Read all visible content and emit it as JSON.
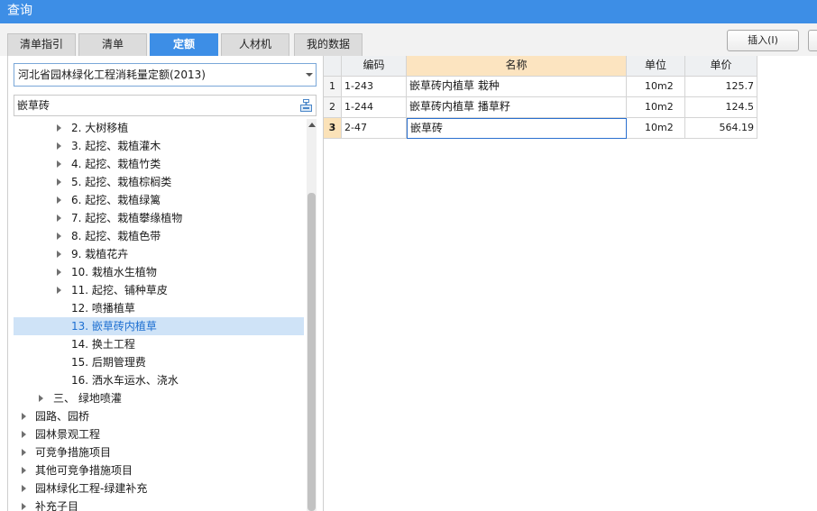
{
  "window": {
    "title": "查询"
  },
  "tabs": [
    {
      "label": "清单指引",
      "active": false
    },
    {
      "label": "清单",
      "active": false
    },
    {
      "label": "定额",
      "active": true
    },
    {
      "label": "人材机",
      "active": false
    },
    {
      "label": "我的数据",
      "active": false
    }
  ],
  "toolbar": {
    "insert_label": "插入(I)"
  },
  "colors": {
    "accent": "#3d8ee6",
    "selection": "#cfe3f7",
    "header_highlight": "#fce4c0"
  },
  "left": {
    "library_select": {
      "value": "河北省园林绿化工程消耗量定额(2013)"
    },
    "search": {
      "value": "嵌草砖",
      "icon": "filter-icon"
    },
    "tree": [
      {
        "label": "2.  大树移植",
        "expandable": true
      },
      {
        "label": "3.  起挖、栽植灌木",
        "expandable": true
      },
      {
        "label": "4.  起挖、栽植竹类",
        "expandable": true
      },
      {
        "label": "5.  起挖、栽植棕榈类",
        "expandable": true
      },
      {
        "label": "6.  起挖、栽植绿篱",
        "expandable": true
      },
      {
        "label": "7.  起挖、栽植攀缘植物",
        "expandable": true
      },
      {
        "label": "8.  起挖、栽植色带",
        "expandable": true
      },
      {
        "label": "9.  栽植花卉",
        "expandable": true
      },
      {
        "label": "10.  栽植水生植物",
        "expandable": true
      },
      {
        "label": "11.  起挖、铺种草皮",
        "expandable": true
      },
      {
        "label": "12.  喷播植草",
        "expandable": false
      },
      {
        "label": "13.  嵌草砖内植草",
        "expandable": false,
        "selected": true
      },
      {
        "label": "14.  换土工程",
        "expandable": false
      },
      {
        "label": "15.  后期管理费",
        "expandable": false
      },
      {
        "label": "16.  洒水车运水、浇水",
        "expandable": false
      },
      {
        "label": "三、  绿地喷灌",
        "expandable": true
      },
      {
        "label": "园路、园桥",
        "expandable": true
      },
      {
        "label": "园林景观工程",
        "expandable": true
      },
      {
        "label": "可竞争措施项目",
        "expandable": true
      },
      {
        "label": "其他可竞争措施项目",
        "expandable": true
      },
      {
        "label": "园林绿化工程-绿建补充",
        "expandable": true
      },
      {
        "label": "补充子目",
        "expandable": true
      }
    ]
  },
  "grid": {
    "columns": [
      "编码",
      "名称",
      "单位",
      "单价"
    ],
    "rows": [
      {
        "num": "1",
        "code": "1-243",
        "name": "嵌草砖内植草 栽种",
        "unit": "10m2",
        "price": "125.7"
      },
      {
        "num": "2",
        "code": "1-244",
        "name": "嵌草砖内植草 播草籽",
        "unit": "10m2",
        "price": "124.5"
      },
      {
        "num": "3",
        "code": "2-47",
        "name": "嵌草砖",
        "unit": "10m2",
        "price": "564.19"
      }
    ]
  }
}
